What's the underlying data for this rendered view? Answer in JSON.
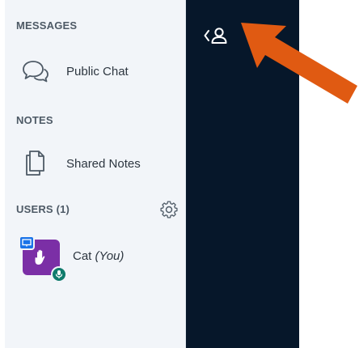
{
  "sections": {
    "messages_title": "MESSAGES",
    "notes_title": "NOTES",
    "users_title": "USERS (1)"
  },
  "messages": {
    "public_chat_label": "Public Chat",
    "icon": "chat-bubbles-icon"
  },
  "notes": {
    "shared_notes_label": "Shared Notes",
    "icon": "document-stack-icon"
  },
  "users": {
    "settings_icon": "gear-icon",
    "list": [
      {
        "name": "Cat",
        "you_label": "(You)",
        "avatar_color": "#7b2fa6",
        "status_icon": "raised-hand-icon",
        "presenter_badge": "presentation-icon",
        "moderator_badge": "microphone-icon"
      }
    ]
  },
  "navbar": {
    "toggle_icon": "toggle-userlist-icon",
    "background": "#06172a"
  },
  "annotation": {
    "arrow_color": "#e05a12",
    "icon": "orange-arrow-pointer"
  }
}
